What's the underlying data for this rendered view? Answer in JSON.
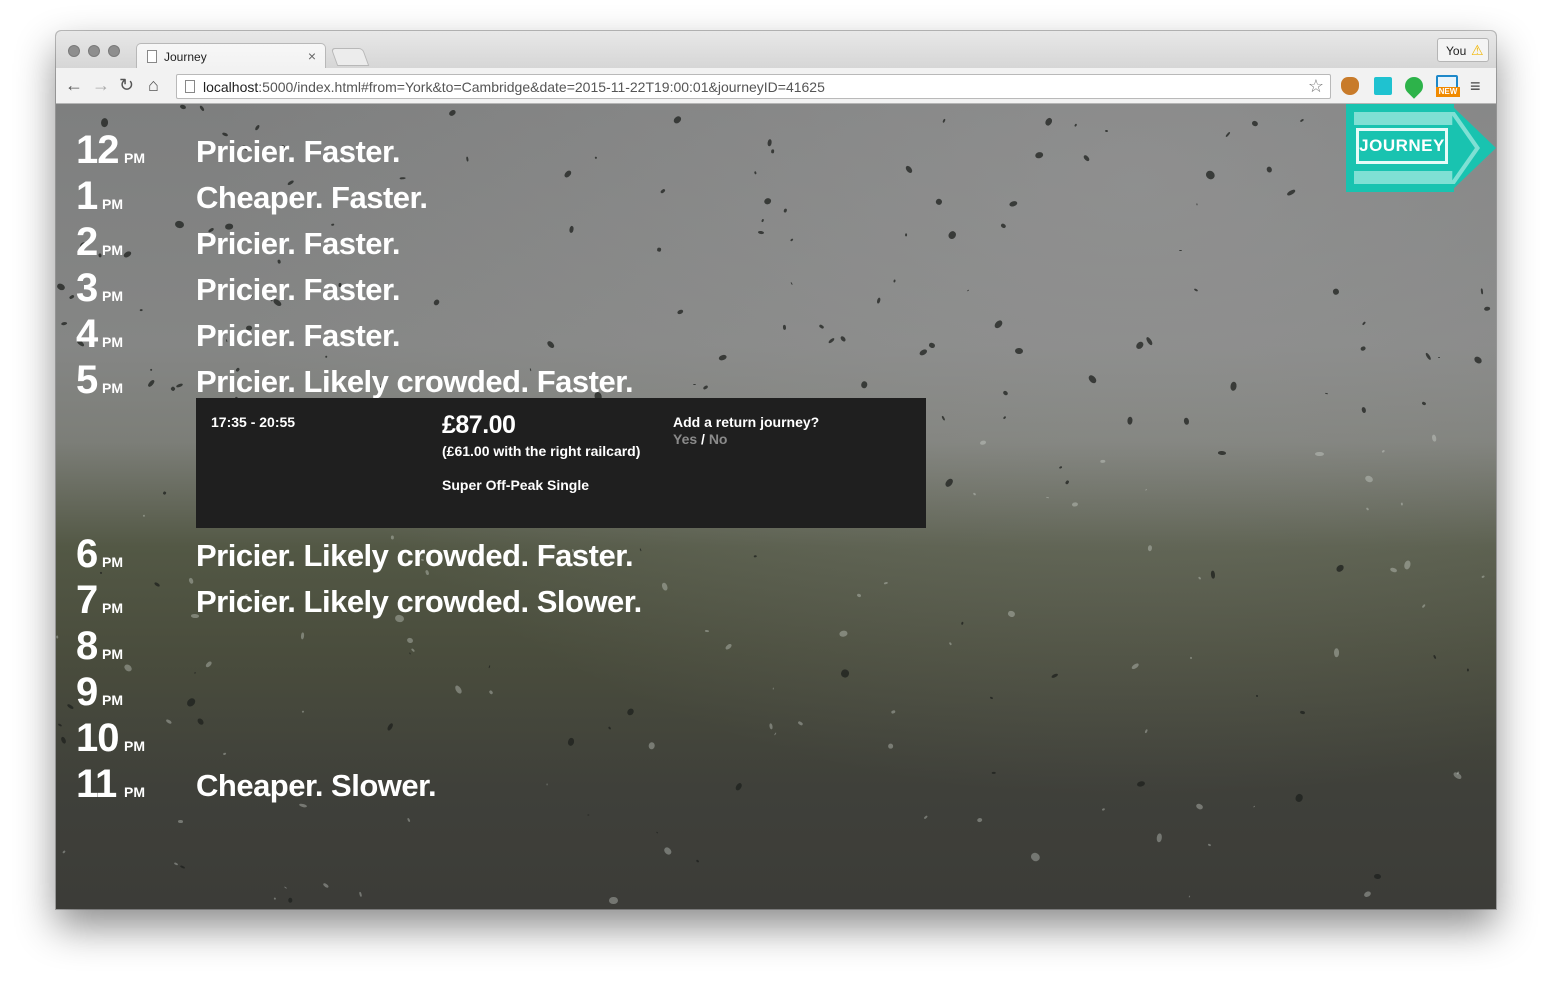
{
  "browser": {
    "tab_title": "Journey",
    "tab_close": "×",
    "profile_label": "You",
    "profile_warning": "⚠",
    "url_host": "localhost",
    "url_rest": ":5000/index.html#from=York&to=Cambridge&date=2015-11-22T19:00:01&journeyID=41625",
    "ext_new_badge": "NEW"
  },
  "logo": {
    "text": "JOURNEY",
    "color": "#19c3b0"
  },
  "schedule": [
    {
      "hour": "12",
      "ampm": "PM",
      "description": "Pricier. Faster."
    },
    {
      "hour": "1",
      "ampm": "PM",
      "description": "Cheaper. Faster."
    },
    {
      "hour": "2",
      "ampm": "PM",
      "description": "Pricier. Faster."
    },
    {
      "hour": "3",
      "ampm": "PM",
      "description": "Pricier. Faster."
    },
    {
      "hour": "4",
      "ampm": "PM",
      "description": "Pricier. Faster."
    },
    {
      "hour": "5",
      "ampm": "PM",
      "description": "Pricier. Likely crowded. Faster."
    },
    {
      "hour": "6",
      "ampm": "PM",
      "description": "Pricier. Likely crowded. Faster."
    },
    {
      "hour": "7",
      "ampm": "PM",
      "description": "Pricier. Likely crowded. Slower."
    },
    {
      "hour": "8",
      "ampm": "PM",
      "description": ""
    },
    {
      "hour": "9",
      "ampm": "PM",
      "description": ""
    },
    {
      "hour": "10",
      "ampm": "PM",
      "description": ""
    },
    {
      "hour": "11",
      "ampm": "PM",
      "description": "Cheaper. Slower."
    }
  ],
  "details": {
    "time_range": "17:35 - 20:55",
    "price": "£87.00",
    "railcard_price": "(£61.00 with the right railcard)",
    "ticket_type": "Super Off-Peak Single",
    "return_prompt": "Add a return journey?",
    "yes": "Yes",
    "separator": "/",
    "no": "No"
  }
}
